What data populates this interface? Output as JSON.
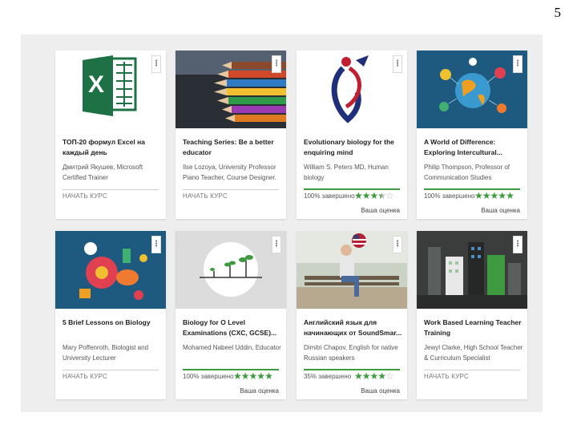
{
  "page_number": "5",
  "colors": {
    "accent_green": "#3e9a3e",
    "panel_bg": "#eeeeee"
  },
  "cards": [
    {
      "thumb": "excel-logo",
      "title": "ТОП-20 формул Excel на каждый день",
      "author": "Дмитрий Якушев, Microsoft Certified Trainer",
      "status": "start",
      "action_label": "НАЧАТЬ КУРС"
    },
    {
      "thumb": "colored-pencils",
      "title": "Teaching Series: Be a better educator",
      "author": "Ilse Lozoya, University Professor Piano Teacher, Course Designer.",
      "status": "start",
      "action_label": "НАЧАТЬ КУРС"
    },
    {
      "thumb": "dna-figure",
      "title": "Evolutionary biology for the enquiring mind",
      "author": "William S. Peters MD, Human biology",
      "status": "progress",
      "progress_text": "100% завершено",
      "rating": 3.5,
      "rating_label": "Ваша оценка"
    },
    {
      "thumb": "globe-icons",
      "title": "A World of Difference: Exploring Intercultural...",
      "author": "Philip Thompson, Professor of Communication Studies",
      "status": "progress",
      "progress_text": "100% завершено",
      "rating": 5,
      "rating_label": "Ваша оценка"
    },
    {
      "thumb": "biology-icons",
      "title": "5 Brief Lessons on Biology",
      "author": "Mary Poffenroth, Biologist and University Lecturer",
      "status": "start",
      "action_label": "НАЧАТЬ КУРС"
    },
    {
      "thumb": "plant-growth",
      "title": "Biology for O Level Examinations (CXC, GCSE)...",
      "author": "Mohamed Nabeel Uddin, Educator",
      "status": "progress",
      "progress_text": "100% завершено",
      "rating": 5,
      "rating_label": "Ваша оценка"
    },
    {
      "thumb": "woman-bench-flag",
      "title": "Английский язык для начинающих от SoundSmar...",
      "author": "Dimitri Chapov, English for native Russian speakers",
      "status": "progress",
      "progress_text": "35% завершено",
      "rating": 4,
      "rating_label": "Ваша оценка"
    },
    {
      "thumb": "city-chalkboard",
      "title": "Work Based Learning Teacher Training",
      "author": "Jewyl Clarke, High School Teacher & Curriculum Specialist",
      "status": "start",
      "action_label": "НАЧАТЬ КУРС"
    }
  ]
}
